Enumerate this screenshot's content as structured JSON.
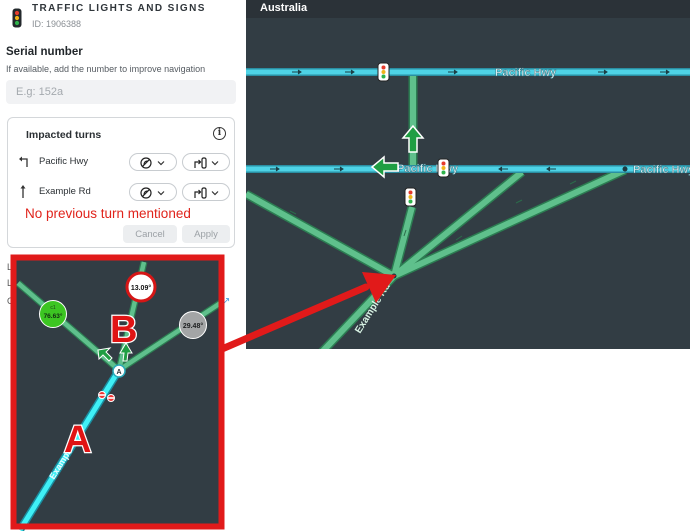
{
  "panel": {
    "title": "TRAFFIC LIGHTS AND SIGNS",
    "id_text": "ID: 1906388",
    "serial_label": "Serial number",
    "serial_help": "If available, add the number to improve navigation",
    "serial_placeholder": "E.g: 152a",
    "impacted_title": "Impacted turns",
    "info_glyph": "i",
    "turns": [
      {
        "label": "Pacific Hwy"
      },
      {
        "label": "Example Rd"
      }
    ],
    "annotation": "No previous turn mentioned",
    "cancel_label": "Cancel",
    "apply_label": "Apply",
    "peek_letters": [
      "L",
      "L",
      "C"
    ]
  },
  "map": {
    "region_title": "Australia",
    "road_labels": [
      "Pacific Hwy",
      "Pacific Hwy",
      "Pacific Hwy",
      "Example Rd"
    ]
  },
  "inset": {
    "marker_a": "A",
    "marker_b": "B",
    "node_letter": "A",
    "badges": [
      {
        "line1": "c1",
        "line2": "76.63°"
      },
      {
        "line1": "",
        "line2": "13.09°"
      },
      {
        "line1": "",
        "line2": "29.48°"
      }
    ],
    "road_fragments": [
      "Exampl",
      "xai"
    ]
  },
  "colors": {
    "map_bg": "#323d44",
    "map_bar": "#2b3238",
    "road_blue": "#4ed3e6",
    "road_green": "#57c38e",
    "annotation_red": "#e11a1a",
    "marker_red": "#d51616",
    "badge_green": "#3cc522",
    "badge_grey": "#a3a5a6"
  },
  "icons": [
    "traffic-light-icon",
    "info-icon",
    "turn-left-arrow-icon",
    "straight-arrow-icon",
    "turn-restriction-icon",
    "chevron-down-icon",
    "no-entry-icon"
  ]
}
